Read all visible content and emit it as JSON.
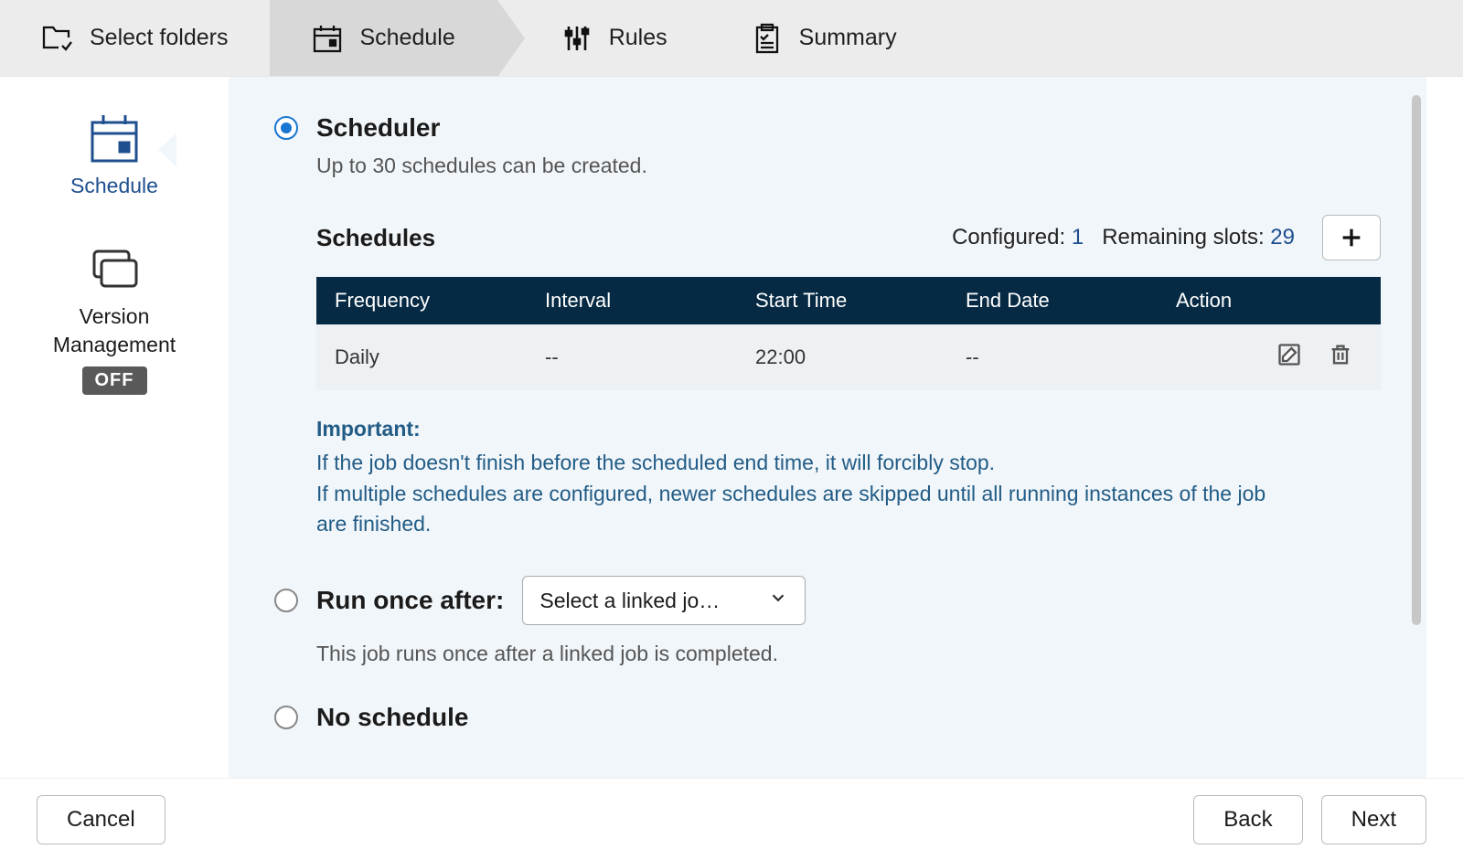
{
  "stepper": {
    "select_folders": "Select folders",
    "schedule": "Schedule",
    "rules": "Rules",
    "summary": "Summary"
  },
  "sidenav": {
    "schedule": "Schedule",
    "version_line1": "Version",
    "version_line2": "Management",
    "off_badge": "OFF"
  },
  "scheduler": {
    "title": "Scheduler",
    "subtitle": "Up to 30 schedules can be created.",
    "table_title": "Schedules",
    "configured_label": "Configured:",
    "configured_value": "1",
    "remaining_label": "Remaining slots:",
    "remaining_value": "29",
    "columns": {
      "frequency": "Frequency",
      "interval": "Interval",
      "start_time": "Start Time",
      "end_date": "End Date",
      "action": "Action"
    },
    "rows": [
      {
        "frequency": "Daily",
        "interval": "--",
        "start_time": "22:00",
        "end_date": "--"
      }
    ],
    "note_head": "Important:",
    "note_line1": "If the job doesn't finish before the scheduled end time, it will forcibly stop.",
    "note_line2": "If multiple schedules are configured, newer schedules are skipped until all running instances of the job are finished."
  },
  "run_once": {
    "title": "Run once after:",
    "select_placeholder": "Select a linked jo…",
    "subtitle": "This job runs once after a linked job is completed."
  },
  "no_schedule": {
    "title": "No schedule"
  },
  "footer": {
    "cancel": "Cancel",
    "back": "Back",
    "next": "Next"
  }
}
